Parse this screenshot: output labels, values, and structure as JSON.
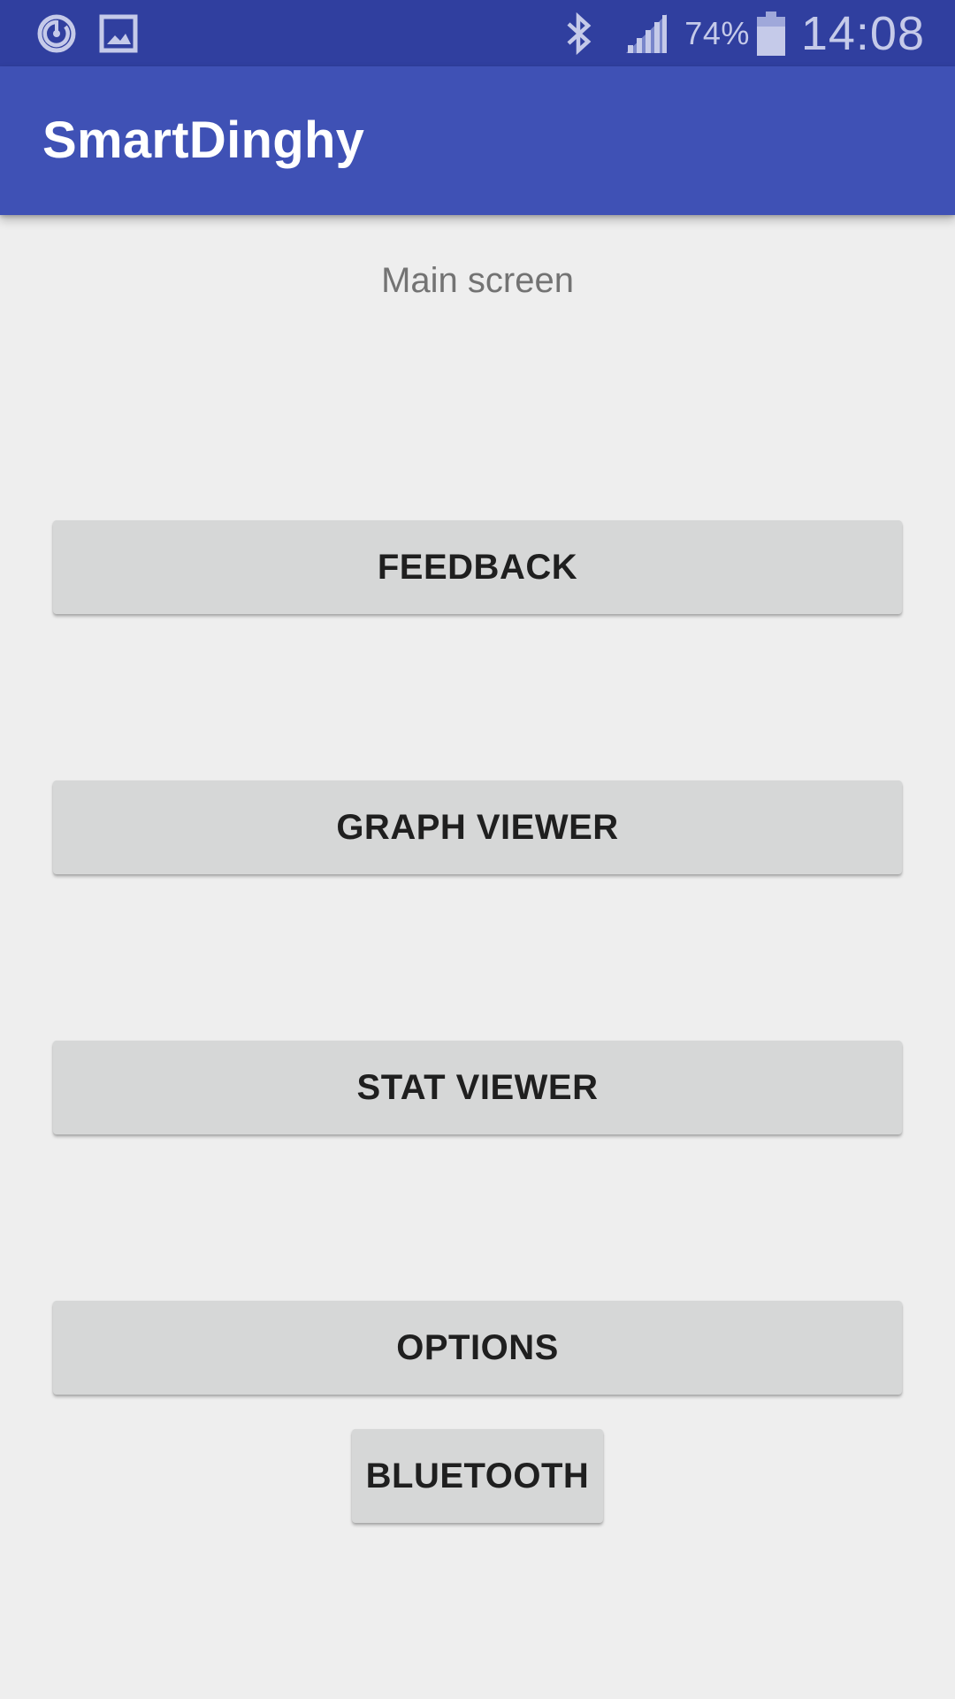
{
  "status_bar": {
    "left_icons": [
      "sync-circle-icon",
      "image-icon"
    ],
    "right_icons": [
      "bluetooth-icon",
      "signal-icon",
      "battery-icon"
    ],
    "battery_percent": "74%",
    "time": "14:08"
  },
  "app_bar": {
    "title": "SmartDinghy"
  },
  "main": {
    "screen_label": "Main screen",
    "buttons": {
      "feedback": "FEEDBACK",
      "graph_viewer": "GRAPH VIEWER",
      "stat_viewer": "STAT VIEWER",
      "options": "OPTIONS",
      "bluetooth": "BLUETOOTH"
    }
  },
  "colors": {
    "status_bar": "#303f9f",
    "app_bar": "#3f51b5",
    "background": "#eeeeee",
    "button": "#d6d7d7",
    "status_icon": "#c5cae9"
  }
}
